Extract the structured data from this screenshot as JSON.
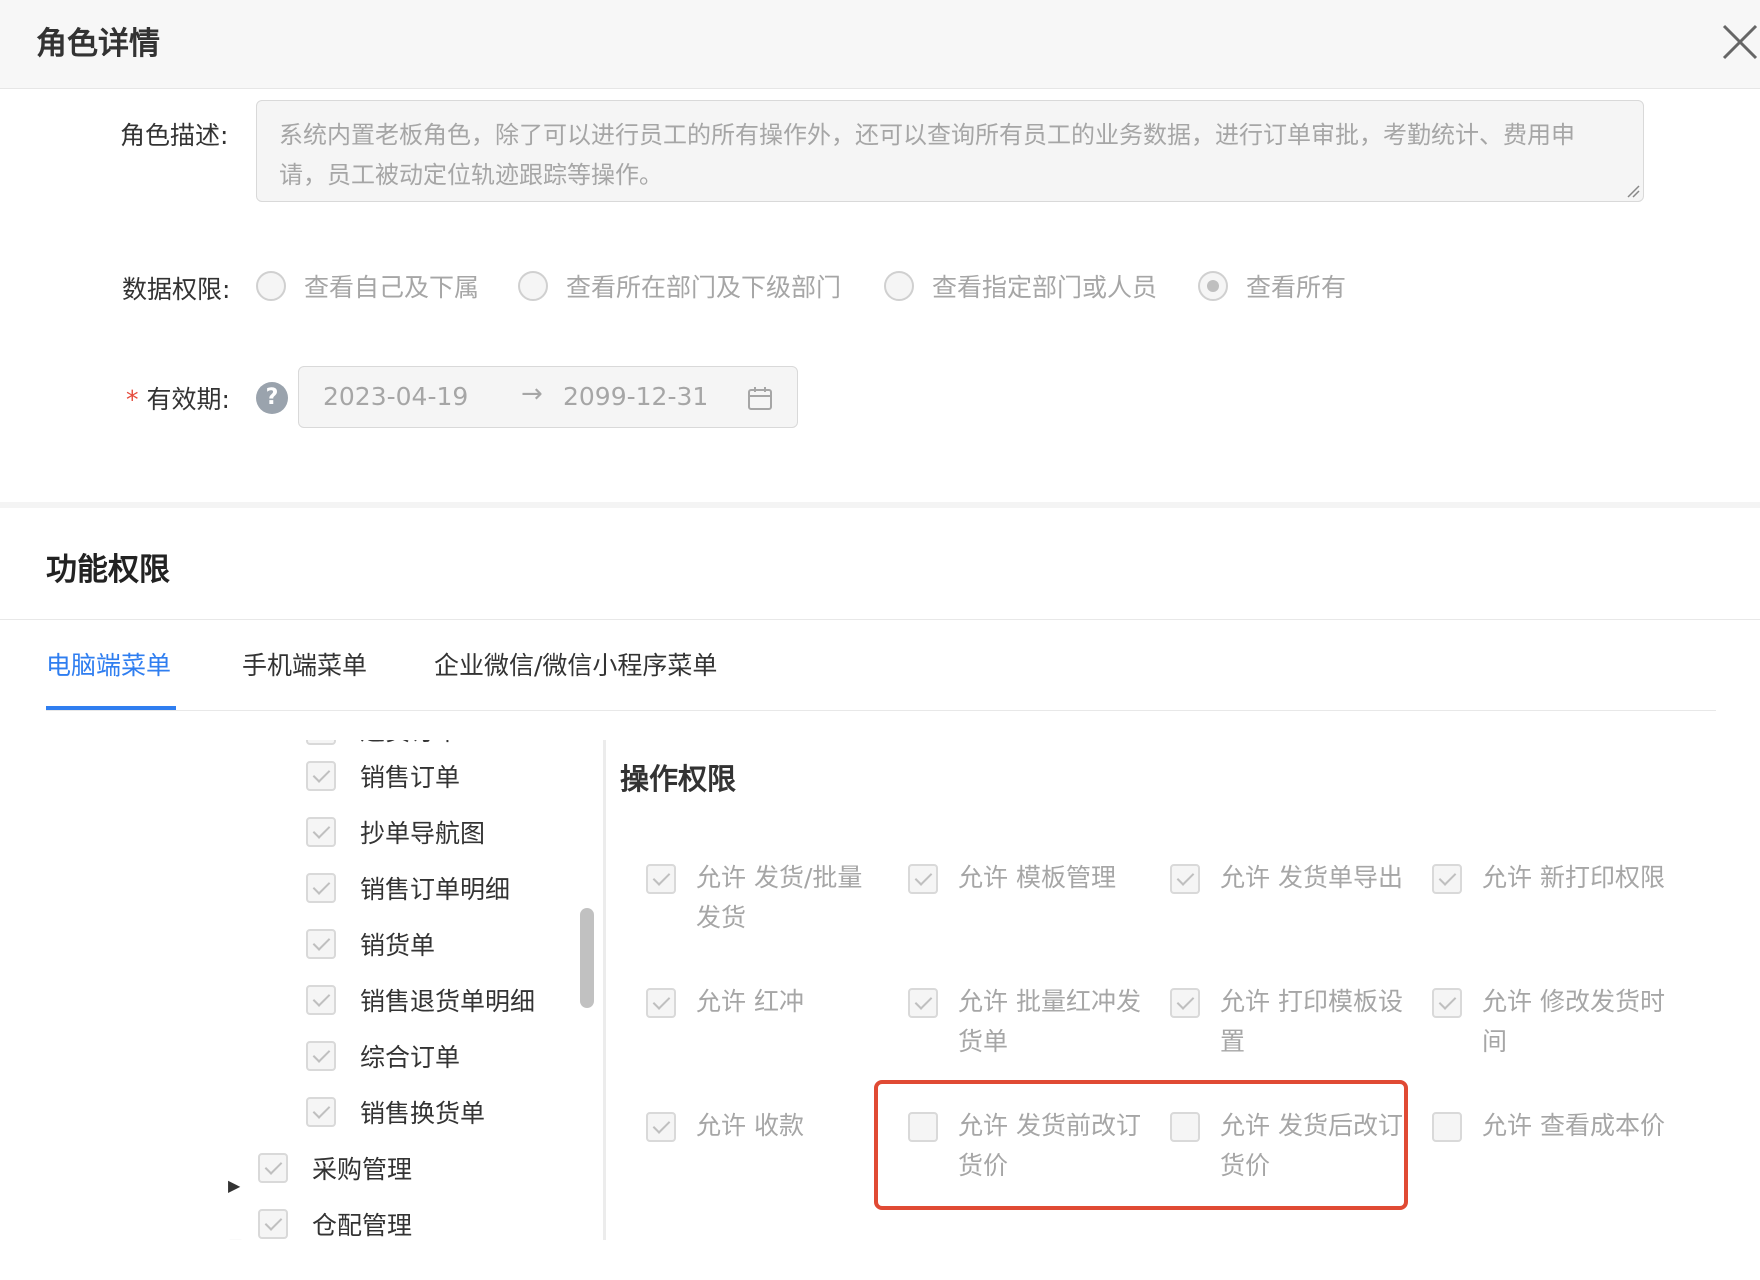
{
  "header": {
    "title": "角色详情"
  },
  "form": {
    "description_label": "角色描述:",
    "description_value": "系统内置老板角色，除了可以进行员工的所有操作外，还可以查询所有员工的业务数据，进行订单审批，考勤统计、费用申请，员工被动定位轨迹跟踪等操作。",
    "data_permission_label": "数据权限:",
    "data_permission_options": [
      {
        "label": "查看自己及下属",
        "checked": false
      },
      {
        "label": "查看所在部门及下级部门",
        "checked": false
      },
      {
        "label": "查看指定部门或人员",
        "checked": false
      },
      {
        "label": "查看所有",
        "checked": true
      }
    ],
    "required_mark": "*",
    "validity_label": "有效期:",
    "validity_help": "?",
    "validity_start": "2023-04-19",
    "validity_arrow": "→",
    "validity_end": "2099-12-31"
  },
  "function_permissions": {
    "title": "功能权限",
    "tabs": [
      {
        "label": "电脑端菜单",
        "active": true
      },
      {
        "label": "手机端菜单",
        "active": false
      },
      {
        "label": "企业微信/微信小程序菜单",
        "active": false
      }
    ],
    "tree_items": [
      {
        "label": "退货订单",
        "checked": true
      },
      {
        "label": "销售订单",
        "checked": true
      },
      {
        "label": "抄单导航图",
        "checked": true
      },
      {
        "label": "销售订单明细",
        "checked": true
      },
      {
        "label": "销货单",
        "checked": true
      },
      {
        "label": "销售退货单明细",
        "checked": true
      },
      {
        "label": "综合订单",
        "checked": true
      },
      {
        "label": "销售换货单",
        "checked": true
      },
      {
        "label": "采购管理",
        "checked": true
      },
      {
        "label": "仓配管理",
        "checked": true
      }
    ],
    "operations_title": "操作权限",
    "operations": [
      {
        "label": "允许 发货/批量发货",
        "checked": true
      },
      {
        "label": "允许 模板管理",
        "checked": true
      },
      {
        "label": "允许 发货单导出",
        "checked": true
      },
      {
        "label": "允许 新打印权限",
        "checked": true
      },
      {
        "label": "允许 红冲",
        "checked": true
      },
      {
        "label": "允许 批量红冲发货单",
        "checked": true
      },
      {
        "label": "允许 打印模板设置",
        "checked": true
      },
      {
        "label": "允许 修改发货时间",
        "checked": true
      },
      {
        "label": "允许 收款",
        "checked": true
      },
      {
        "label": "允许 发货前改订货价",
        "checked": false
      },
      {
        "label": "允许 发货后改订货价",
        "checked": false
      },
      {
        "label": "允许 查看成本价",
        "checked": false
      }
    ]
  },
  "colors": {
    "accent": "#2f7ef0",
    "highlight": "#e04a34",
    "required": "#e54b3c"
  }
}
